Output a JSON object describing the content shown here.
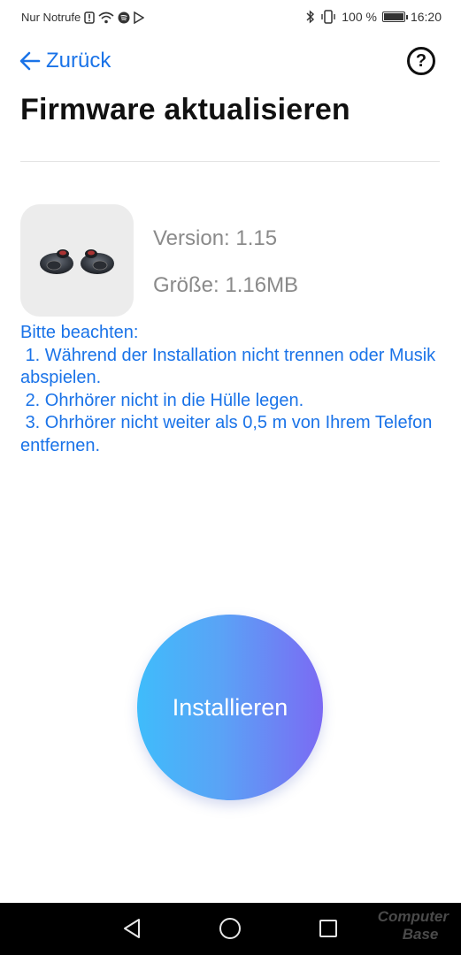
{
  "status_bar": {
    "carrier": "Nur Notrufe",
    "battery": "100 %",
    "battery_level": 1.0,
    "time": "16:20",
    "icons": [
      "alert-icon",
      "wifi-icon",
      "spotify-icon",
      "play-store-icon",
      "bluetooth-icon",
      "vibrate-icon",
      "battery-icon"
    ]
  },
  "header": {
    "back_label": "Zurück",
    "help_icon": "?",
    "title": "Firmware aktualisieren"
  },
  "firmware": {
    "version": "Version: 1.15",
    "size": "Größe: 1.16MB"
  },
  "notes": {
    "heading": "Bitte beachten:",
    "items": [
      " 1. Während der Installation nicht trennen oder Musik abspielen.",
      " 2. Ohrhörer nicht in die Hülle legen.",
      " 3. Ohrhörer nicht weiter als 0,5 m von Ihrem Telefon entfernen."
    ]
  },
  "install_button": {
    "label": "Installieren"
  },
  "watermark": {
    "line1": "Computer",
    "line2": "Base"
  },
  "colors": {
    "accent": "#1a73e8",
    "title": "#111111",
    "muted": "#8a8a8a",
    "button_gradient_start": "#3fbcfb",
    "button_gradient_end": "#7b6af3"
  }
}
